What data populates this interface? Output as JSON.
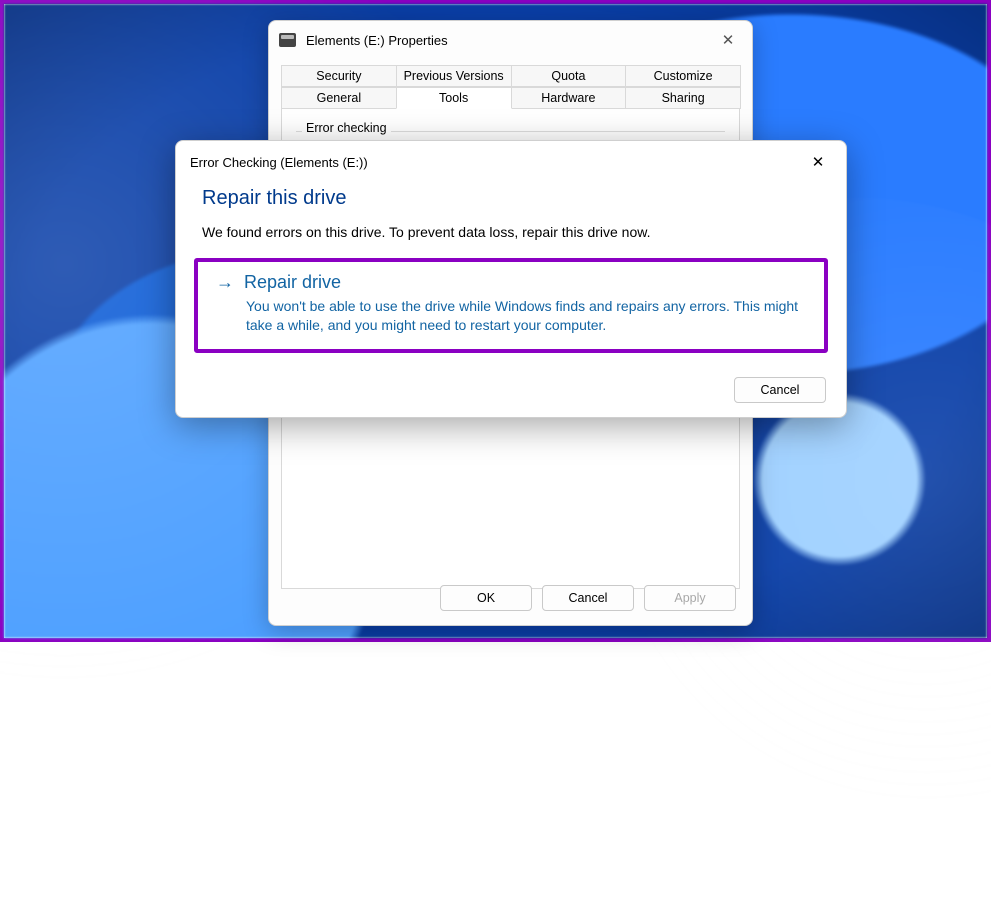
{
  "properties": {
    "title": "Elements (E:) Properties",
    "tabs_row1": [
      "Security",
      "Previous Versions",
      "Quota",
      "Customize"
    ],
    "tabs_row2": [
      "General",
      "Tools",
      "Hardware",
      "Sharing"
    ],
    "active_tab": "Tools",
    "group_label": "Error checking",
    "buttons": {
      "ok": "OK",
      "cancel": "Cancel",
      "apply": "Apply"
    }
  },
  "dialog": {
    "title": "Error Checking (Elements (E:))",
    "heading": "Repair this drive",
    "message": "We found errors on this drive. To prevent data loss, repair this drive now.",
    "option": {
      "title": "Repair drive",
      "subtitle": "You won't be able to use the drive while Windows finds and repairs any errors. This might take a while, and you might need to restart your computer."
    },
    "cancel": "Cancel"
  }
}
